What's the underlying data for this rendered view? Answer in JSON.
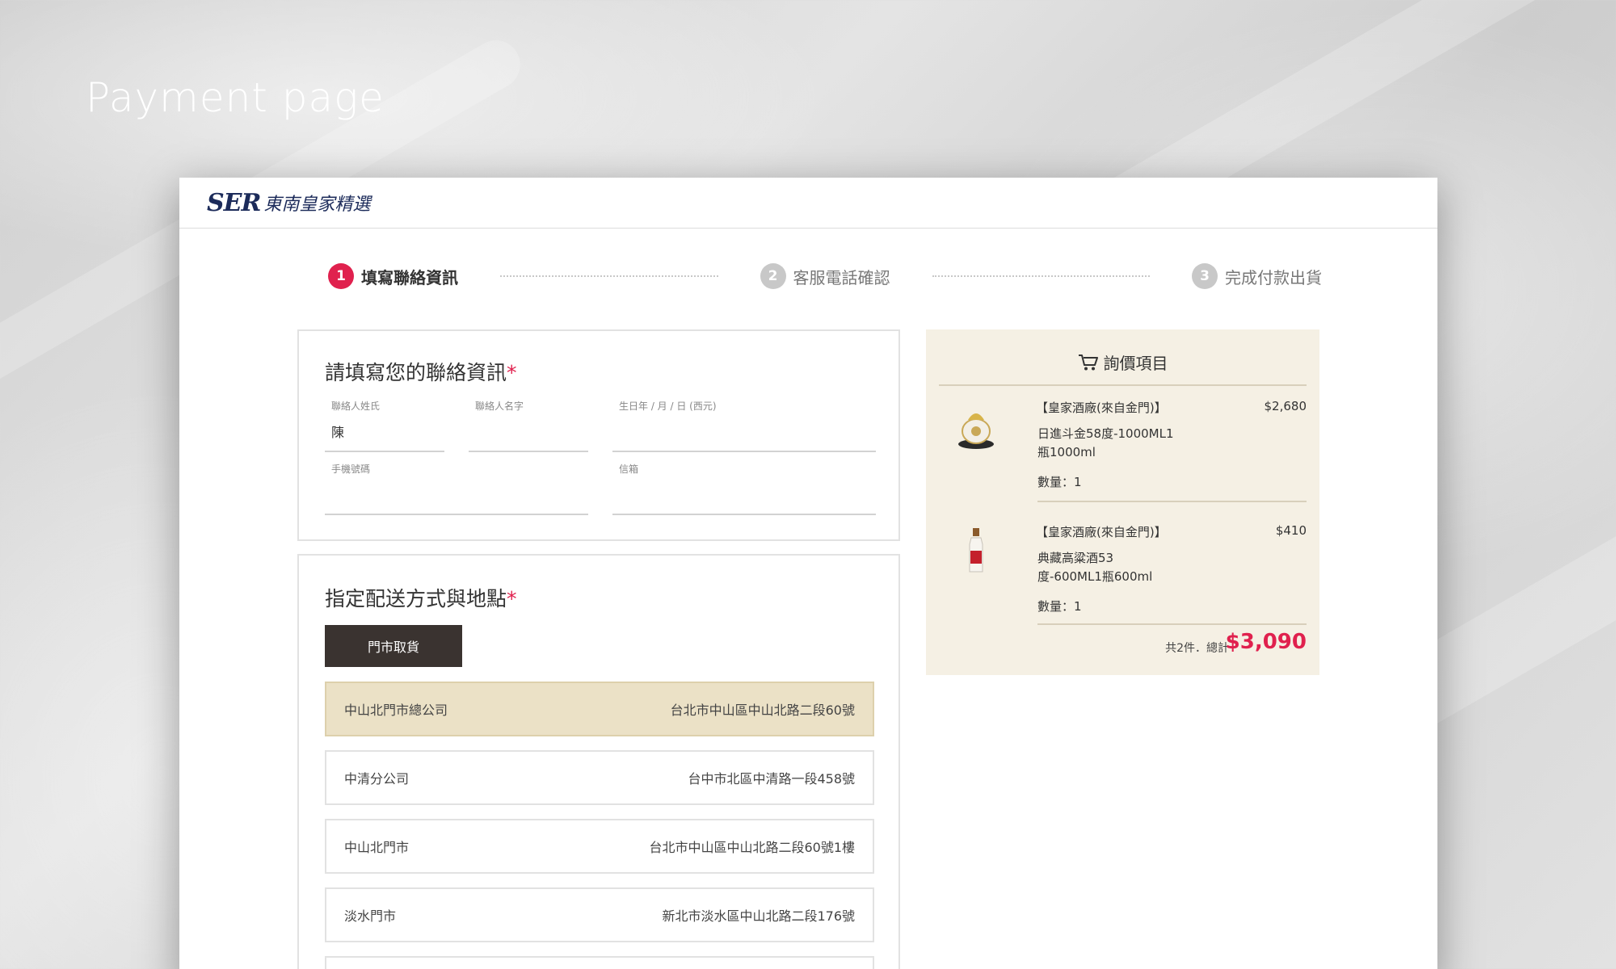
{
  "page_heading": "Payment page",
  "header": {
    "logo_mark": "SER",
    "logo_text": "東南皇家精選"
  },
  "steps": [
    {
      "number": "1",
      "label": "填寫聯絡資訊",
      "active": true
    },
    {
      "number": "2",
      "label": "客服電話確認",
      "active": false
    },
    {
      "number": "3",
      "label": "完成付款出貨",
      "active": false
    }
  ],
  "contact": {
    "title": "請填寫您的聯絡資訊",
    "required_mark": "*",
    "surname": {
      "label": "聯絡人姓氏",
      "value": "陳"
    },
    "given_name": {
      "label": "聯絡人名字",
      "value": ""
    },
    "birthday": {
      "label": "生日年 / 月 / 日 (西元)",
      "value": ""
    },
    "phone": {
      "label": "手機號碼",
      "value": ""
    },
    "email": {
      "label": "信箱",
      "value": ""
    }
  },
  "delivery": {
    "title": "指定配送方式與地點",
    "required_mark": "*",
    "pickup_button": "門市取貨",
    "stores": [
      {
        "name": "中山北門市總公司",
        "address": "台北市中山區中山北路二段60號",
        "selected": true
      },
      {
        "name": "中清分公司",
        "address": "台中市北區中清路一段458號",
        "selected": false
      },
      {
        "name": "中山北門市",
        "address": "台北市中山區中山北路二段60號1樓",
        "selected": false
      },
      {
        "name": "淡水門市",
        "address": "新北市淡水區中山北路二段176號",
        "selected": false
      }
    ]
  },
  "summary": {
    "title": "詢價項目",
    "items": [
      {
        "brand": "【皇家酒廠(來自金門)】",
        "price": "$2,680",
        "name_line1": "日進斗金58度-1000ML1",
        "name_line2": "瓶1000ml",
        "qty": "數量：1"
      },
      {
        "brand": "【皇家酒廠(來自金門)】",
        "price": "$410",
        "name_line1": "典藏高粱酒53",
        "name_line2": "度-600ML1瓶600ml",
        "qty": "數量：1"
      }
    ],
    "total_label": "共2件．總計",
    "total_value": "$3,090"
  },
  "colors": {
    "accent": "#e0214e",
    "selected_store": "#ebe1c6",
    "summary_bg": "#f5f0e4",
    "button_dark": "#3a3330"
  }
}
